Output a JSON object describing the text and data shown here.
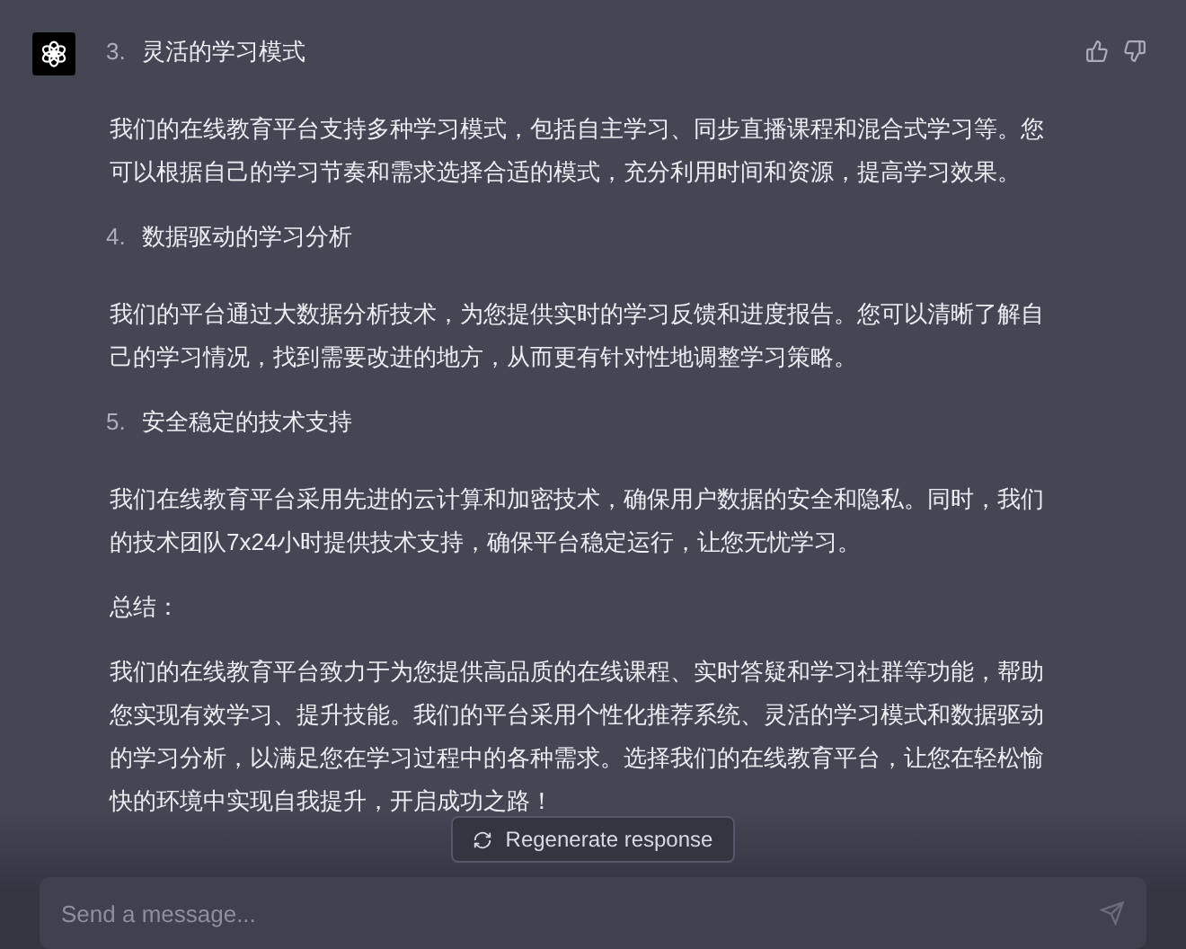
{
  "message": {
    "sections": [
      {
        "kind": "heading",
        "number": "3.",
        "text": "灵活的学习模式"
      },
      {
        "kind": "paragraph",
        "text": "我们的在线教育平台支持多种学习模式，包括自主学习、同步直播课程和混合式学习等。您可以根据自己的学习节奏和需求选择合适的模式，充分利用时间和资源，提高学习效果。"
      },
      {
        "kind": "heading",
        "number": "4.",
        "text": "数据驱动的学习分析"
      },
      {
        "kind": "paragraph",
        "text": "我们的平台通过大数据分析技术，为您提供实时的学习反馈和进度报告。您可以清晰了解自己的学习情况，找到需要改进的地方，从而更有针对性地调整学习策略。"
      },
      {
        "kind": "heading",
        "number": "5.",
        "text": "安全稳定的技术支持"
      },
      {
        "kind": "paragraph",
        "text": "我们在线教育平台采用先进的云计算和加密技术，确保用户数据的安全和隐私。同时，我们的技术团队7x24小时提供技术支持，确保平台稳定运行，让您无忧学习。"
      },
      {
        "kind": "paragraph",
        "text": "总结："
      },
      {
        "kind": "paragraph",
        "text": "我们的在线教育平台致力于为您提供高品质的在线课程、实时答疑和学习社群等功能，帮助您实现有效学习、提升技能。我们的平台采用个性化推荐系统、灵活的学习模式和数据驱动的学习分析，以满足您在学习过程中的各种需求。选择我们的在线教育平台，让您在轻松愉快的环境中实现自我提升，开启成功之路！"
      }
    ]
  },
  "regenerate_button": {
    "label": "Regenerate response"
  },
  "composer": {
    "placeholder": "Send a message..."
  }
}
